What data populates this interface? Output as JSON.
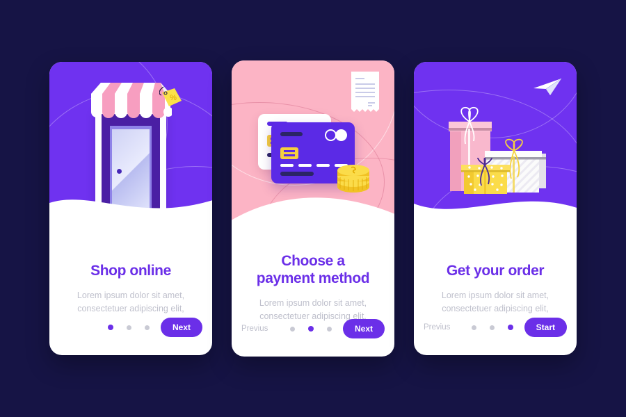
{
  "background_color": "#161445",
  "accent_color": "#6b2fe8",
  "cards": [
    {
      "id": "shop-online",
      "hero_background": "#6f32f0",
      "illustration": "storefront-tablet-icon",
      "title": "Shop online",
      "description": "Lorem ipsum dolor sit amet, consectetuer adipiscing elit,",
      "prev_label": "",
      "cta_label": "Next",
      "active_dot": 0,
      "dot_count": 3
    },
    {
      "id": "choose-payment-method",
      "hero_background": "#fcb4c5",
      "illustration": "credit-card-coins-receipt-icon",
      "title_line1": "Choose a",
      "title_line2": "payment method",
      "description": "Lorem ipsum dolor sit amet, consectetuer adipiscing elit,",
      "prev_label": "Previus",
      "cta_label": "Next",
      "active_dot": 1,
      "dot_count": 3
    },
    {
      "id": "get-your-order",
      "hero_background": "#6f32f0",
      "illustration": "gift-boxes-paper-plane-icon",
      "title": "Get your order",
      "description": "Lorem ipsum dolor sit amet, consectetuer adipiscing elit,",
      "prev_label": "Previus",
      "cta_label": "Start",
      "active_dot": 2,
      "dot_count": 3
    }
  ]
}
